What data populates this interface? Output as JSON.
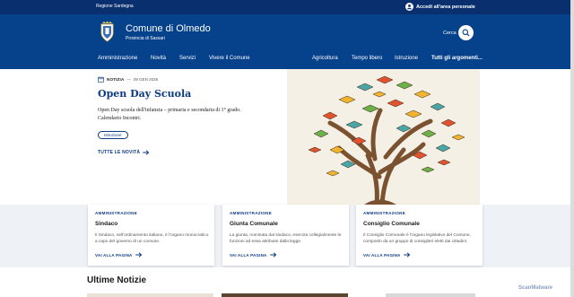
{
  "topbar": {
    "region": "Regione Sardegna",
    "login_label": "Accedi all'area personale"
  },
  "header": {
    "title": "Comune di Olmedo",
    "subtitle": "Provincia di Sassari",
    "search_label": "Cerca"
  },
  "nav": {
    "items": [
      "Amministrazione",
      "Novità",
      "Servizi",
      "Vivere il Comune",
      "Agricoltura",
      "Tempo libero",
      "Istruzione",
      "Tutti gli argomenti..."
    ]
  },
  "hero": {
    "tag": "NOTIZIA",
    "date": "09 GEN 2026",
    "title": "Open Day Scuola",
    "description": "Open Day scuola dell'infanzia – primaria e secondaria di 1° grado. Calendario Incontri.",
    "chip": "Istruzione",
    "link": "TUTTE LE NOVITÀ"
  },
  "cards": [
    {
      "category": "AMMINISTRAZIONE",
      "title": "Sindaco",
      "text": "Il Sindaco, nell'ordinamento italiano, è l'organo monocratico a capo del governo di un comune.",
      "link": "VAI ALLA PAGINA"
    },
    {
      "category": "AMMINISTRAZIONE",
      "title": "Giunta Comunale",
      "text": "La giunta, nominata dal sindaco, esercita collegialmente le funzioni ad essa attribuite dalla legge.",
      "link": "VAI ALLA PAGINA"
    },
    {
      "category": "AMMINISTRAZIONE",
      "title": "Consiglio Comunale",
      "text": "Il Consiglio Comunale è l'organo legislativo del Comune, composto da un gruppo di consiglieri eletti dai cittadini.",
      "link": "VAI ALLA PAGINA"
    }
  ],
  "latest": {
    "title": "Ultime Notizie"
  },
  "watermark": "ScanMalware",
  "colors": {
    "topbar": "#0a2f6e",
    "header": "#06418c",
    "accent": "#0b3a85",
    "cards_bg": "#eef1f6"
  }
}
